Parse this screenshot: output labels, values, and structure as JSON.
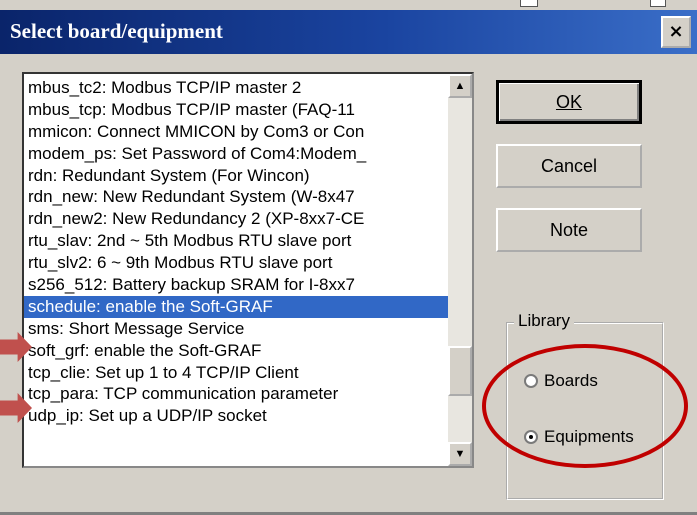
{
  "window": {
    "title": "Select board/equipment",
    "close_glyph": "×"
  },
  "list": {
    "items": [
      "mbus_tc2: Modbus TCP/IP master 2",
      "mbus_tcp: Modbus TCP/IP master (FAQ-11",
      "mmicon: Connect MMICON by Com3 or Con",
      "modem_ps: Set Password of Com4:Modem_",
      "rdn: Redundant System (For Wincon)",
      "rdn_new: New Redundant System (W-8x47",
      "rdn_new2: New Redundancy 2 (XP-8xx7-CE",
      "rtu_slav: 2nd ~ 5th Modbus RTU slave port",
      "rtu_slv2: 6 ~ 9th Modbus RTU slave port",
      "s256_512: Battery backup SRAM for I-8xx7",
      "schedule: enable the Soft-GRAF",
      "sms: Short Message Service",
      "soft_grf: enable the Soft-GRAF",
      "tcp_clie: Set up 1 to 4 TCP/IP Client",
      "tcp_para: TCP communication parameter",
      "udp_ip: Set up a UDP/IP socket"
    ],
    "selected_index": 10,
    "scroll_up_glyph": "▲",
    "scroll_down_glyph": "▼"
  },
  "buttons": {
    "ok": "OK",
    "cancel": "Cancel",
    "note": "Note"
  },
  "library": {
    "label": "Library",
    "options": [
      "Boards",
      "Equipments"
    ],
    "selected": "Equipments"
  },
  "colors": {
    "selection": "#3168c6",
    "annotation_red": "#c00000"
  }
}
